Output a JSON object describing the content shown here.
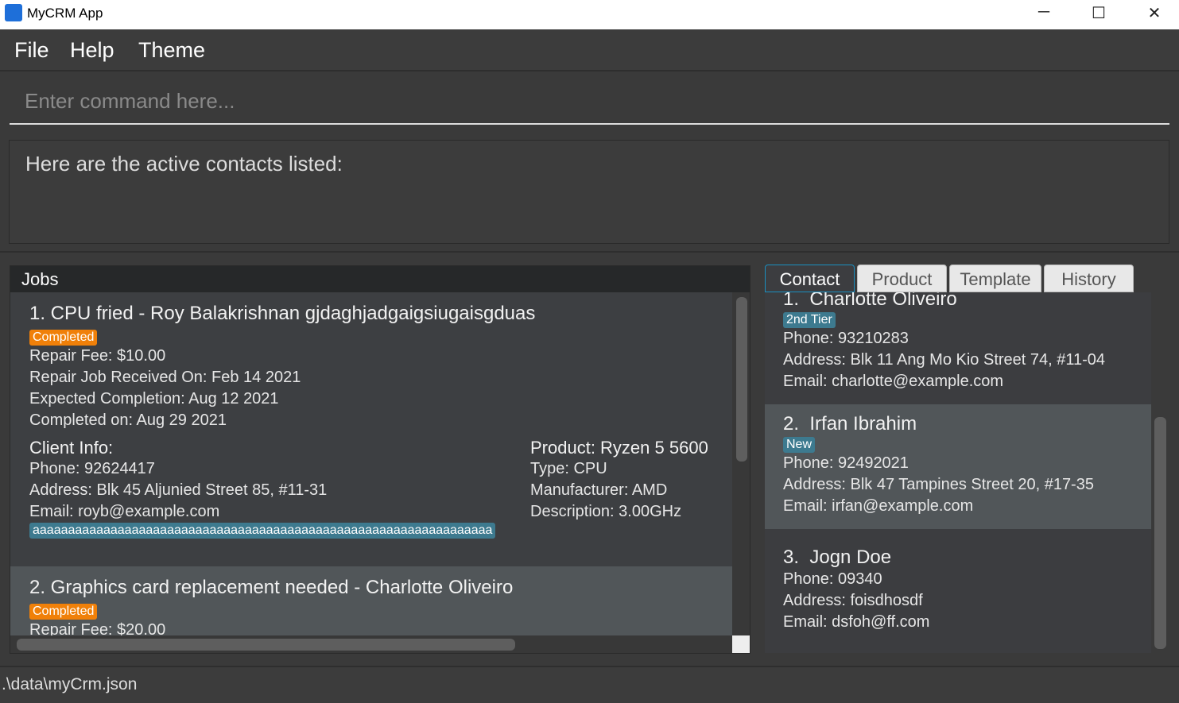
{
  "window": {
    "title": "MyCRM App",
    "minimize": "─",
    "maximize": "☐",
    "close": "✕"
  },
  "menu": [
    "File",
    "Help",
    "Theme"
  ],
  "command": {
    "placeholder": "Enter command here..."
  },
  "result": "Here are the active contacts listed:",
  "jobs": {
    "header": "Jobs",
    "items": [
      {
        "title": "1. CPU fried - Roy Balakrishnan gjdaghjadgaigsiugaisgduas",
        "status": "Completed",
        "fee": "Repair Fee: $10.00",
        "received": "Repair Job Received On: Feb 14 2021",
        "expected": "Expected Completion: Aug 12 2021",
        "completed": "Completed on: Aug 29 2021",
        "client_title": "Client Info:",
        "phone": "Phone: 92624417",
        "address": "Address: Blk 45 Aljunied Street 85, #11-31",
        "email": "Email: royb@example.com",
        "tag": "aaaaaaaaaaaaaaaaaaaaaaaaaaaaaaaaaaaaaaaaaaaaaaaaaaaaaaaaaaaaaaaaa",
        "product_title": "Product: Ryzen 5 5600",
        "type": "Type: CPU",
        "manufacturer": "Manufacturer: AMD",
        "description": "Description: 3.00GHz"
      },
      {
        "title": "2. Graphics card replacement needed - Charlotte Oliveiro",
        "status": "Completed",
        "fee": "Repair Fee: $20.00"
      }
    ]
  },
  "tabs": [
    "Contact",
    "Product",
    "Template",
    "History"
  ],
  "active_tab": "Contact",
  "contacts": [
    {
      "index": "1.",
      "name": "Charlotte Oliveiro",
      "tag": "2nd Tier",
      "phone": "Phone: 93210283",
      "address": "Address: Blk 11 Ang Mo Kio Street 74, #11-04",
      "email": "Email: charlotte@example.com"
    },
    {
      "index": "2.",
      "name": "Irfan Ibrahim",
      "tag": "New",
      "phone": "Phone: 92492021",
      "address": "Address: Blk 47 Tampines Street 20, #17-35",
      "email": "Email: irfan@example.com"
    },
    {
      "index": "3.",
      "name": "Jogn Doe",
      "phone": "Phone: 09340",
      "address": "Address: foisdhosdf",
      "email": "Email: dsfoh@ff.com"
    }
  ],
  "status": ".\\data\\myCrm.json",
  "colors": {
    "status_completed": "#f08009",
    "tag": "#3d7a8f",
    "selected": "#515659"
  }
}
